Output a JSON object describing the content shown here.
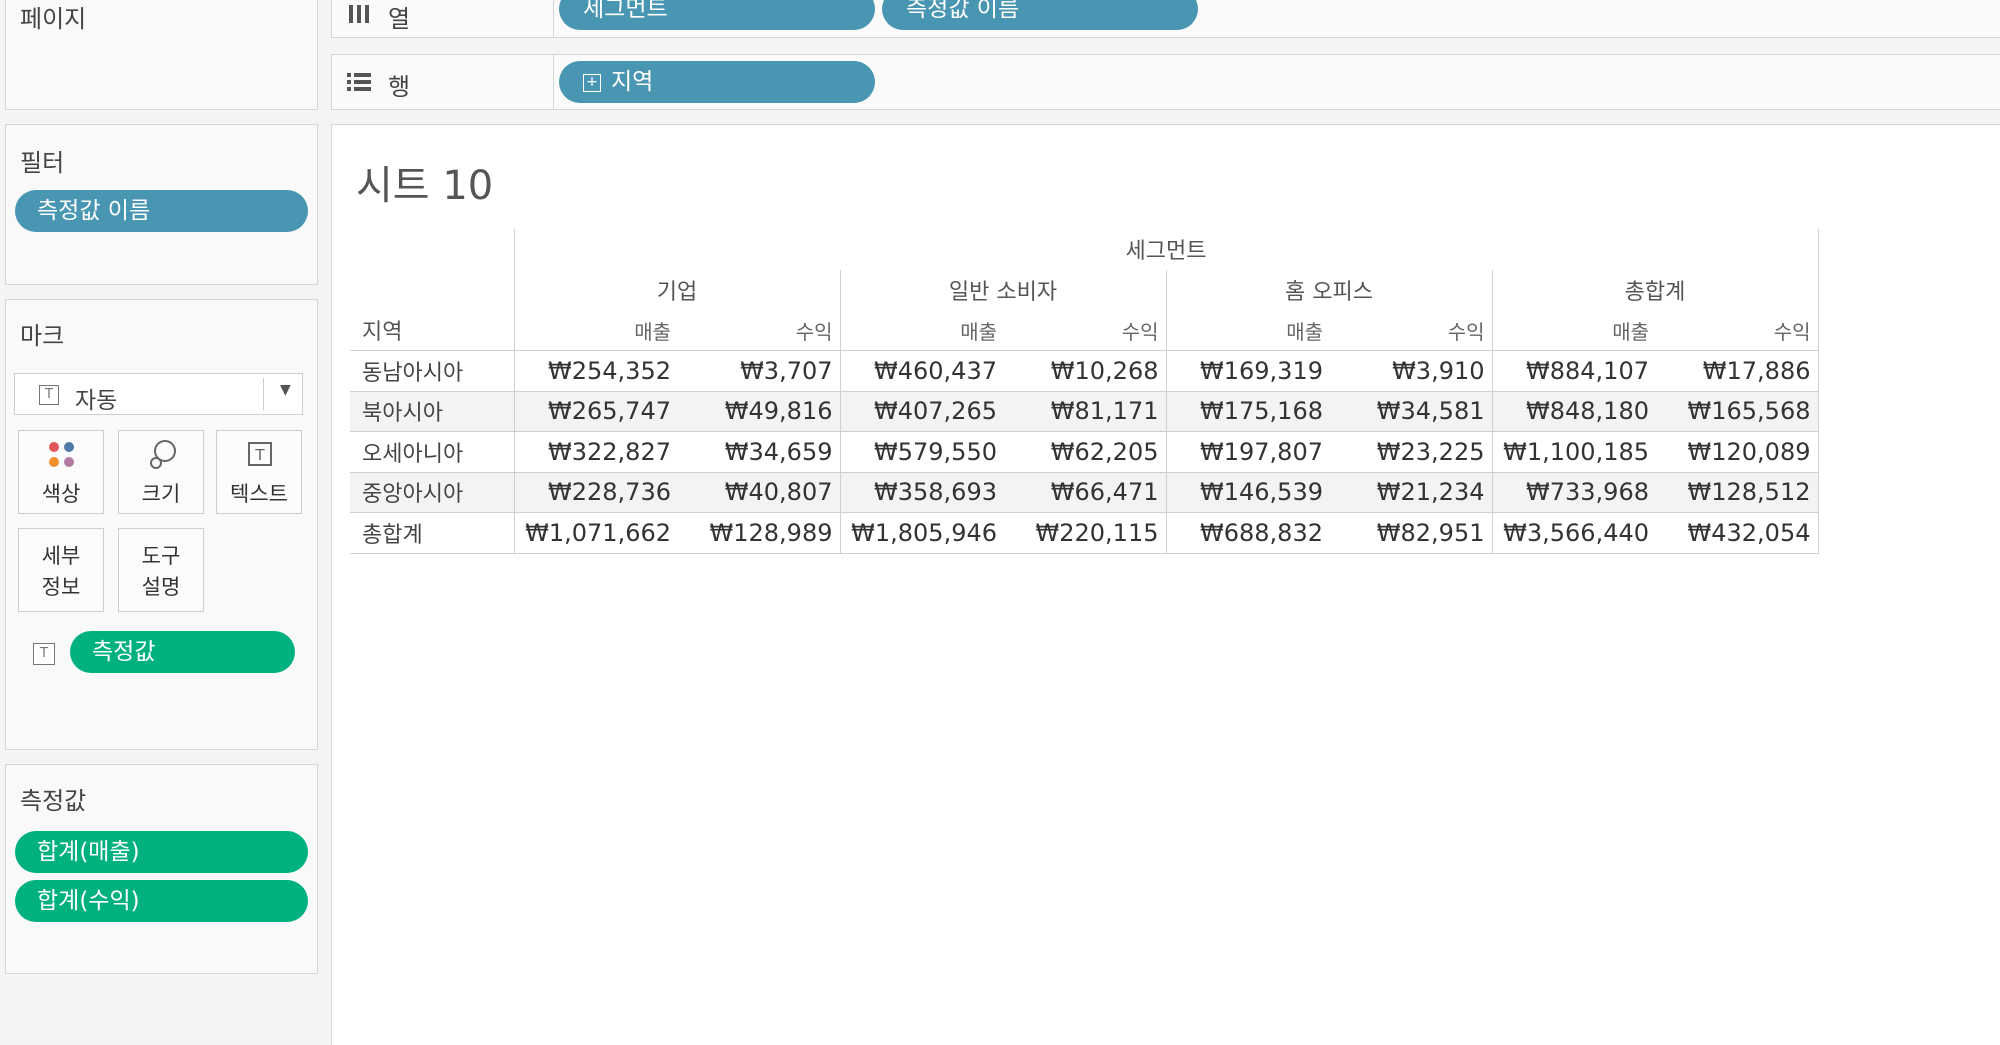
{
  "left_panel": {
    "pages": {
      "title": "페이지"
    },
    "filters": {
      "title": "필터",
      "pills": [
        "측정값 이름"
      ]
    },
    "marks": {
      "title": "마크",
      "type_selected": "자동",
      "buttons": {
        "color": "색상",
        "size": "크기",
        "text": "텍스트",
        "detail_line1": "세부",
        "detail_line2": "정보",
        "tooltip_line1": "도구",
        "tooltip_line2": "설명"
      },
      "text_pill": "측정값"
    },
    "measure_values": {
      "title": "측정값",
      "pills": [
        "합계(매출)",
        "합계(수익)"
      ]
    }
  },
  "shelves": {
    "columns": {
      "label": "열",
      "pills": [
        "세그먼트",
        "측정값 이름"
      ]
    },
    "rows": {
      "label": "행",
      "pills": [
        "지역"
      ]
    }
  },
  "sheet": {
    "title": "시트 10",
    "crosstab": {
      "top_header": "세그먼트",
      "row_dimension": "지역",
      "segments": [
        "기업",
        "일반 소비자",
        "홈 오피스",
        "총합계"
      ],
      "measures": [
        "매출",
        "수익"
      ],
      "rows": [
        {
          "region": "동남아시아",
          "values": [
            "₩254,352",
            "₩3,707",
            "₩460,437",
            "₩10,268",
            "₩169,319",
            "₩3,910",
            "₩884,107",
            "₩17,886"
          ]
        },
        {
          "region": "북아시아",
          "values": [
            "₩265,747",
            "₩49,816",
            "₩407,265",
            "₩81,171",
            "₩175,168",
            "₩34,581",
            "₩848,180",
            "₩165,568"
          ]
        },
        {
          "region": "오세아니아",
          "values": [
            "₩322,827",
            "₩34,659",
            "₩579,550",
            "₩62,205",
            "₩197,807",
            "₩23,225",
            "₩1,100,185",
            "₩120,089"
          ]
        },
        {
          "region": "중앙아시아",
          "values": [
            "₩228,736",
            "₩40,807",
            "₩358,693",
            "₩66,471",
            "₩146,539",
            "₩21,234",
            "₩733,968",
            "₩128,512"
          ]
        },
        {
          "region": "총합계",
          "values": [
            "₩1,071,662",
            "₩128,989",
            "₩1,805,946",
            "₩220,115",
            "₩688,832",
            "₩82,951",
            "₩3,566,440",
            "₩432,054"
          ]
        }
      ]
    }
  },
  "colors": {
    "dimension_pill": "#4996b2",
    "measure_pill": "#00b180"
  }
}
